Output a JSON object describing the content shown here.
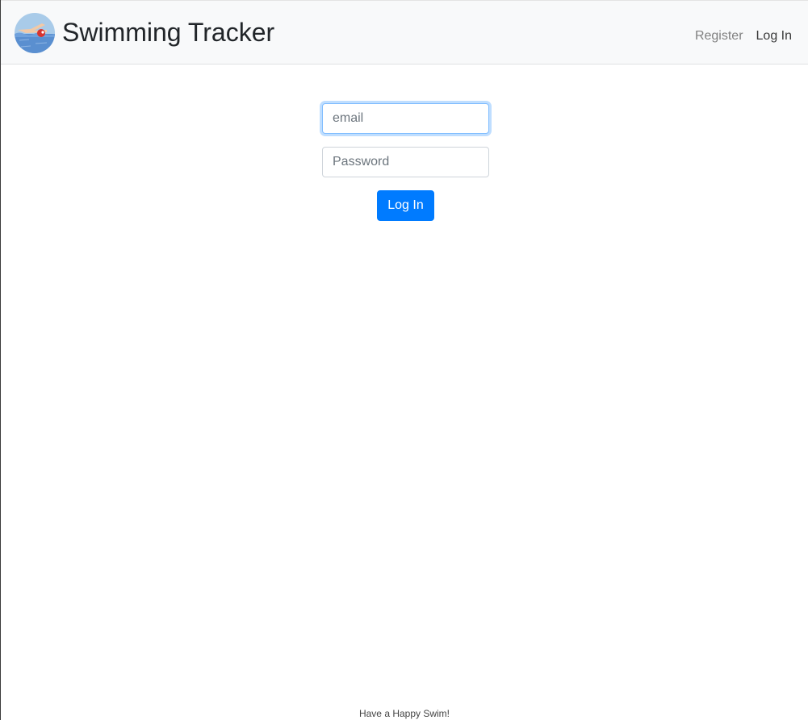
{
  "header": {
    "brand_title": "Swimming Tracker",
    "logo_icon": "swimmer-logo-icon",
    "nav": {
      "register_label": "Register",
      "login_label": "Log In"
    }
  },
  "form": {
    "email_placeholder": "email",
    "email_value": "",
    "password_placeholder": "Password",
    "password_value": "",
    "submit_label": "Log In"
  },
  "footer": {
    "text": "Have a Happy Swim!"
  },
  "colors": {
    "navbar_bg": "#f8f9fa",
    "primary": "#007bff",
    "focus_border": "#80bdff",
    "nav_muted": "#808080"
  }
}
